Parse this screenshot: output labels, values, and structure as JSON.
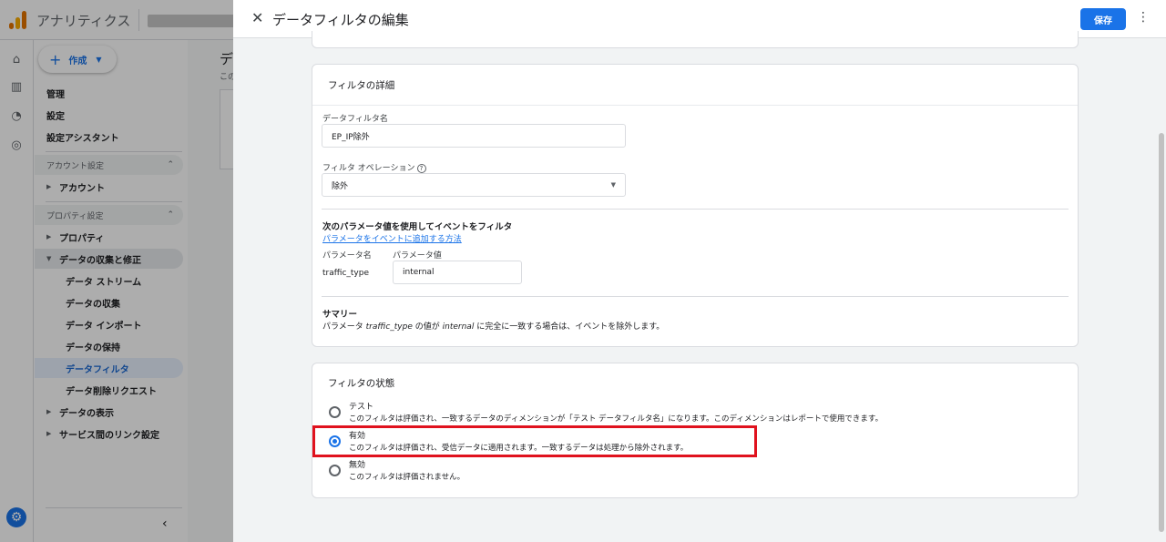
{
  "app": {
    "title": "アナリティクス"
  },
  "rail_icons": [
    "home-icon",
    "reports-icon",
    "explore-icon",
    "advertising-icon",
    "admin-gear-icon"
  ],
  "sidebar": {
    "create_label": "作成",
    "items": [
      {
        "label": "管理"
      },
      {
        "label": "設定"
      },
      {
        "label": "設定アシスタント"
      }
    ],
    "account_section": "アカウント設定",
    "account_item": "アカウント",
    "property_section": "プロパティ設定",
    "property_item": "プロパティ",
    "data_collection": "データの収集と修正",
    "sub_items": [
      {
        "label": "データ ストリーム"
      },
      {
        "label": "データの収集"
      },
      {
        "label": "データ インポート"
      },
      {
        "label": "データの保持"
      },
      {
        "label": "データフィルタ"
      },
      {
        "label": "データ削除リクエスト"
      }
    ],
    "data_display": "データの表示",
    "service_links": "サービス間のリンク設定"
  },
  "main": {
    "title_partial": "デ",
    "desc_partial": "この"
  },
  "panel": {
    "title": "データフィルタの編集",
    "save_label": "保存",
    "details": {
      "header": "フィルタの詳細",
      "name_label": "データフィルタ名",
      "name_value": "EP_IP除外",
      "operation_label": "フィルタ オペレーション",
      "operation_value": "除外",
      "param_section_title": "次のパラメータ値を使用してイベントをフィルタ",
      "param_link": "パラメータをイベントに追加する方法",
      "param_name_header": "パラメータ名",
      "param_value_header": "パラメータ値",
      "param_name": "traffic_type",
      "param_value": "internal",
      "summary_title": "サマリー",
      "summary_prefix": "パラメータ ",
      "summary_param": "traffic_type",
      "summary_mid": " の値が ",
      "summary_value": "internal",
      "summary_suffix": " に完全に一致する場合は、イベントを除外します。"
    },
    "status": {
      "header": "フィルタの状態",
      "options": [
        {
          "title": "テスト",
          "desc": "このフィルタは評価され、一致するデータのディメンションが「テスト データフィルタ名」になります。このディメンションはレポートで使用できます。",
          "checked": false
        },
        {
          "title": "有効",
          "desc": "このフィルタは評価され、受信データに適用されます。一致するデータは処理から除外されます。",
          "checked": true
        },
        {
          "title": "無効",
          "desc": "このフィルタは評価されません。",
          "checked": false
        }
      ]
    }
  },
  "colors": {
    "accent": "#1a73e8",
    "highlight": "#e0121e"
  }
}
